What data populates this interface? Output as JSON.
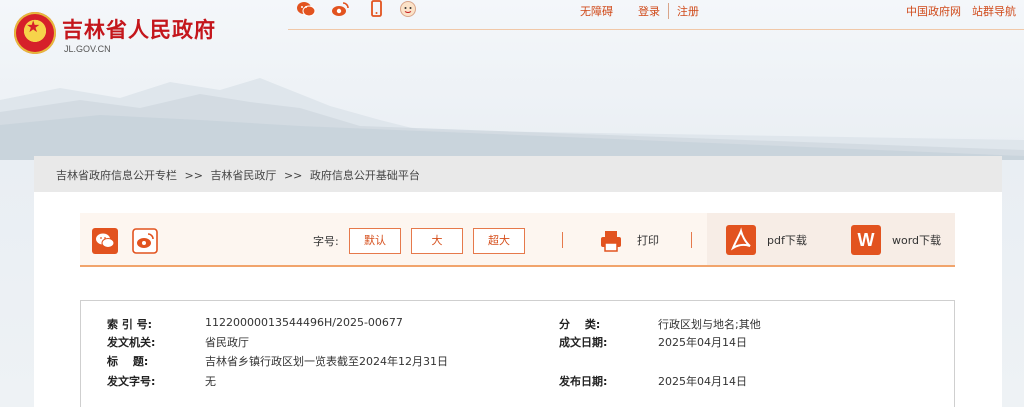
{
  "header": {
    "site_title": "吉林省人民政府",
    "site_domain": "JL.GOV.CN",
    "top_icons": [
      "wechat-icon",
      "weibo-icon",
      "mobile-icon",
      "assistant-avatar-icon"
    ],
    "links": {
      "accessibility": "无障碍",
      "login": "登录",
      "register": "注册",
      "china_gov": "中国政府网",
      "site_nav": "站群导航"
    }
  },
  "breadcrumb": {
    "items": [
      "吉林省政府信息公开专栏",
      "吉林省民政厅",
      "政府信息公开基础平台"
    ],
    "separator": ">>"
  },
  "toolbar": {
    "share_icons": [
      "wechat-icon",
      "weibo-icon"
    ],
    "font_size_label": "字号:",
    "font_sizes": [
      "默认",
      "大",
      "超大"
    ],
    "print_label": "打印",
    "pdf_badge": "pdf-icon",
    "pdf_label": "pdf下载",
    "word_badge": "W",
    "word_label": "word下载"
  },
  "meta": {
    "index_no_label": "索 引 号:",
    "index_no": "11220000013544496H/2025-00677",
    "issuer_label": "发文机关:",
    "issuer": "省民政厅",
    "title_label": "标　 题:",
    "title": "吉林省乡镇行政区划一览表截至2024年12月31日",
    "doc_no_label": "发文字号:",
    "doc_no": "无",
    "category_label": "分　 类:",
    "category": "行政区划与地名;其他",
    "written_date_label": "成文日期:",
    "written_date": "2025年04月14日",
    "publish_date_label": "发布日期:",
    "publish_date": "2025年04月14日"
  },
  "colors": {
    "brand_red": "#c4161c",
    "accent_orange": "#e2531f",
    "link_orange": "#d04a1a"
  }
}
